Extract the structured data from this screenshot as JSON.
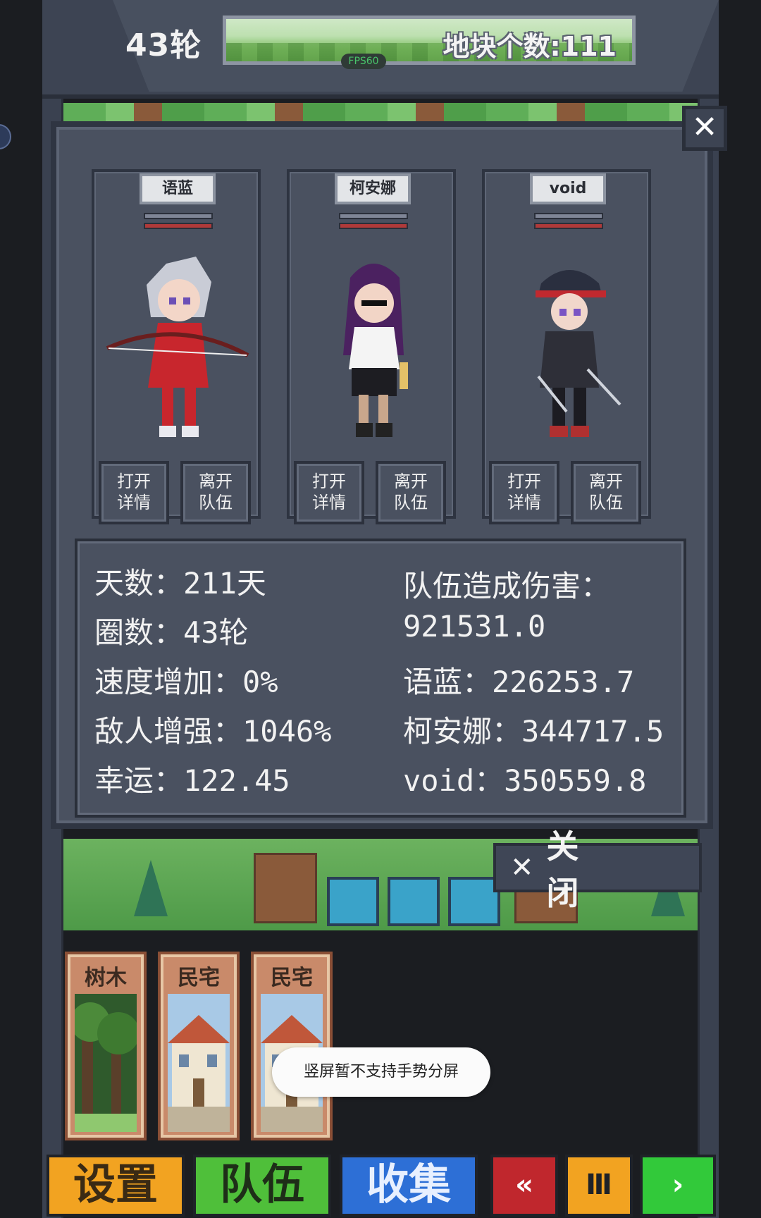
{
  "hud": {
    "round": "43轮",
    "tile_count": "地块个数:111",
    "fps": "FPS60"
  },
  "dialog": {
    "close_symbol": "✕",
    "members": [
      {
        "name": "语蓝",
        "open_details": "打开\n详情",
        "leave_team": "离开\n队伍"
      },
      {
        "name": "柯安娜",
        "open_details": "打开\n详情",
        "leave_team": "离开\n队伍"
      },
      {
        "name": "void",
        "open_details": "打开\n详情",
        "leave_team": "离开\n队伍"
      }
    ],
    "stats": {
      "days": "天数：211天",
      "rounds": "圈数：43轮",
      "speed": "速度增加：0%",
      "enemy": "敌人增强：1046%",
      "luck": "幸运：122.45",
      "damage_label": "队伍造成伤害：",
      "damage_total": "921531.0",
      "member1": "语蓝：226253.7",
      "member2": "柯安娜：344717.5",
      "member3": "void：350559.8"
    }
  },
  "close_bar": {
    "x": "✕",
    "label": "关闭"
  },
  "tile_cards": [
    {
      "label": "树木"
    },
    {
      "label": "民宅"
    },
    {
      "label": "民宅"
    }
  ],
  "toast": "竖屏暂不支持手势分屏",
  "bottom_buttons": {
    "settings": "设置",
    "team": "队伍",
    "collect": "收集",
    "rewind": "«",
    "pause": "Ⅲ",
    "play": "›"
  },
  "colors": {
    "panel": "#4a5160",
    "orange": "#f2a321",
    "green": "#4fbf3a",
    "blue": "#2d6fd6",
    "red": "#c0272d"
  }
}
